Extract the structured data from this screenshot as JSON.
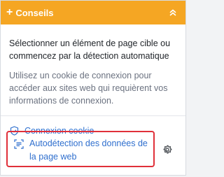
{
  "header": {
    "title": "Conseils",
    "plus_glyph": "+",
    "collapse_icon": "chevron-up-double-icon",
    "background": "#f5a623"
  },
  "content": {
    "primary": "Sélectionner un élément de page cible ou commencez par la détection automatique",
    "secondary": "Utilisez un cookie de connexion pour accéder aux sites web qui requièrent vos informations de connexion."
  },
  "links": {
    "cookie_label": "Connexion cookie",
    "cookie_icon": "shield-check-icon",
    "autodetect_label": "Autodétection des données de la page web",
    "autodetect_icon": "scan-icon",
    "settings_icon": "gear-icon"
  },
  "colors": {
    "link": "#2f6fce",
    "highlight": "#e0303a"
  }
}
